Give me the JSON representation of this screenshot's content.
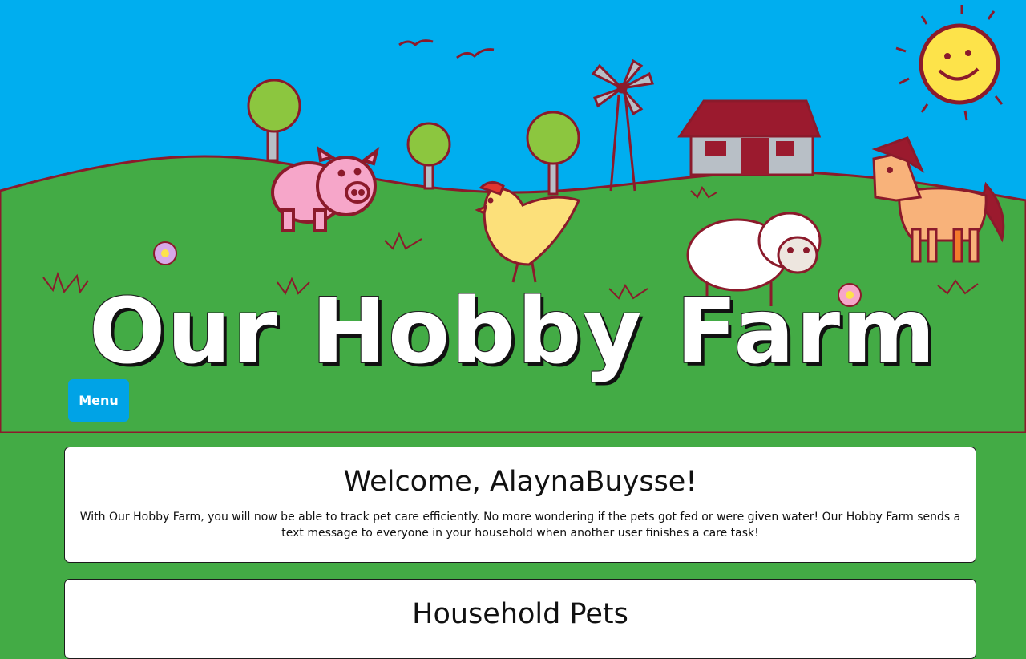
{
  "header": {
    "title": "Our Hobby Farm",
    "banner_icon": "farm-scene"
  },
  "nav": {
    "menu_label": "Menu"
  },
  "welcome": {
    "heading": "Welcome, AlaynaBuysse!",
    "body": "With Our Hobby Farm, you will now be able to track pet care efficiently. No more wondering if the pets got fed or were given water! Our Hobby Farm sends a text message to everyone in your household when another user finishes a care task!"
  },
  "pets": {
    "heading": "Household Pets"
  },
  "colors": {
    "sky": "#00aeef",
    "grass": "#43ab45",
    "accent_button": "#00a3e6",
    "outline": "#8b1a2b"
  }
}
